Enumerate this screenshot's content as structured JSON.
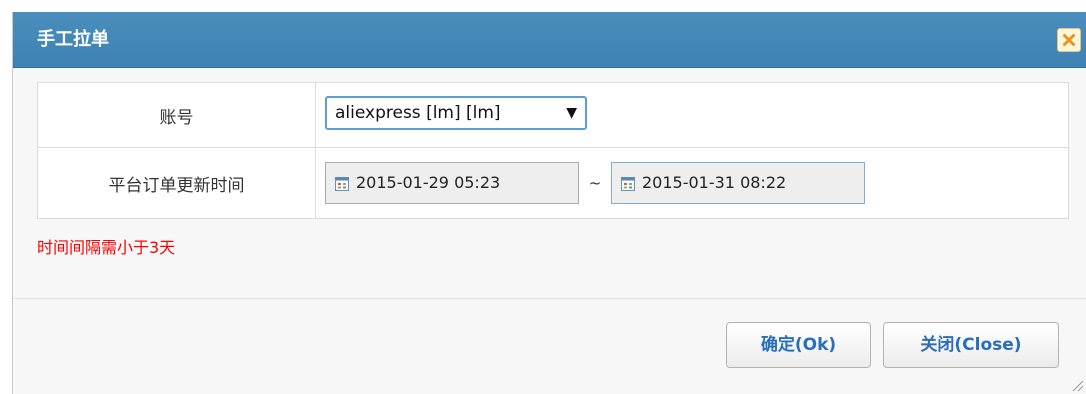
{
  "dialog": {
    "title": "手工拉单",
    "close_icon": "close-icon"
  },
  "form": {
    "account": {
      "label": "账号",
      "selected": "aliexpress [lm] [lm]",
      "arrow": "▼"
    },
    "update_time": {
      "label": "平台订单更新时间",
      "start": "2015-01-29 05:23",
      "separator": "~",
      "end": "2015-01-31 08:22",
      "icon": "calendar-icon"
    }
  },
  "warning": "时间间隔需小于3天",
  "buttons": {
    "ok": "确定(Ok)",
    "close": "关闭(Close)"
  },
  "colors": {
    "titlebar": "#3d82b3",
    "warning": "#ff0000",
    "button_text": "#2a6ebb",
    "close_button_bg": "#fdf6dc",
    "close_x": "#e8941a"
  }
}
